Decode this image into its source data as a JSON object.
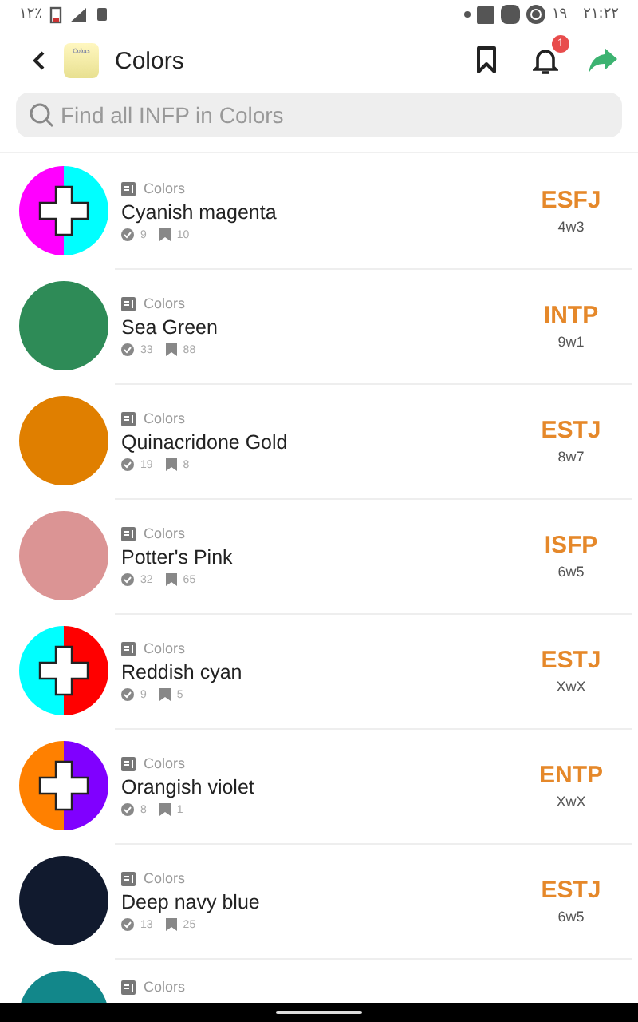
{
  "status_bar": {
    "battery": "١٢٪",
    "date": "١٩",
    "time": "٢١:٢٢"
  },
  "app_bar": {
    "title": "Colors",
    "logo_text": "Colors",
    "notifications": "1"
  },
  "search": {
    "placeholder": "Find all INFP in Colors"
  },
  "items": [
    {
      "kind": "split",
      "halves": [
        {
          "color": "#ff00ff"
        },
        {
          "color": "#00ffff"
        }
      ],
      "category": "Colors",
      "name": "Cyanish magenta",
      "votes": "9",
      "saves": "10",
      "type": "ESFJ",
      "wing": "4w3"
    },
    {
      "kind": "solid",
      "color": "#2e8b57",
      "category": "Colors",
      "name": "Sea Green",
      "votes": "33",
      "saves": "88",
      "type": "INTP",
      "wing": "9w1"
    },
    {
      "kind": "solid",
      "color": "#e07f00",
      "category": "Colors",
      "name": "Quinacridone Gold",
      "votes": "19",
      "saves": "8",
      "type": "ESTJ",
      "wing": "8w7"
    },
    {
      "kind": "solid",
      "color": "#db9494",
      "category": "Colors",
      "name": "Potter's Pink",
      "votes": "32",
      "saves": "65",
      "type": "ISFP",
      "wing": "6w5"
    },
    {
      "kind": "split",
      "halves": [
        {
          "color": "#00ffff"
        },
        {
          "color": "#ff0000"
        }
      ],
      "category": "Colors",
      "name": "Reddish cyan",
      "votes": "9",
      "saves": "5",
      "type": "ESTJ",
      "wing": "XwX"
    },
    {
      "kind": "split",
      "halves": [
        {
          "color": "#ff8000"
        },
        {
          "color": "#8000ff"
        }
      ],
      "category": "Colors",
      "name": "Orangish violet",
      "votes": "8",
      "saves": "1",
      "type": "ENTP",
      "wing": "XwX"
    },
    {
      "kind": "solid",
      "color": "#111a2e",
      "category": "Colors",
      "name": "Deep navy blue",
      "votes": "13",
      "saves": "25",
      "type": "ESTJ",
      "wing": "6w5"
    },
    {
      "kind": "solid",
      "color": "#12878a",
      "category": "Colors"
    }
  ]
}
